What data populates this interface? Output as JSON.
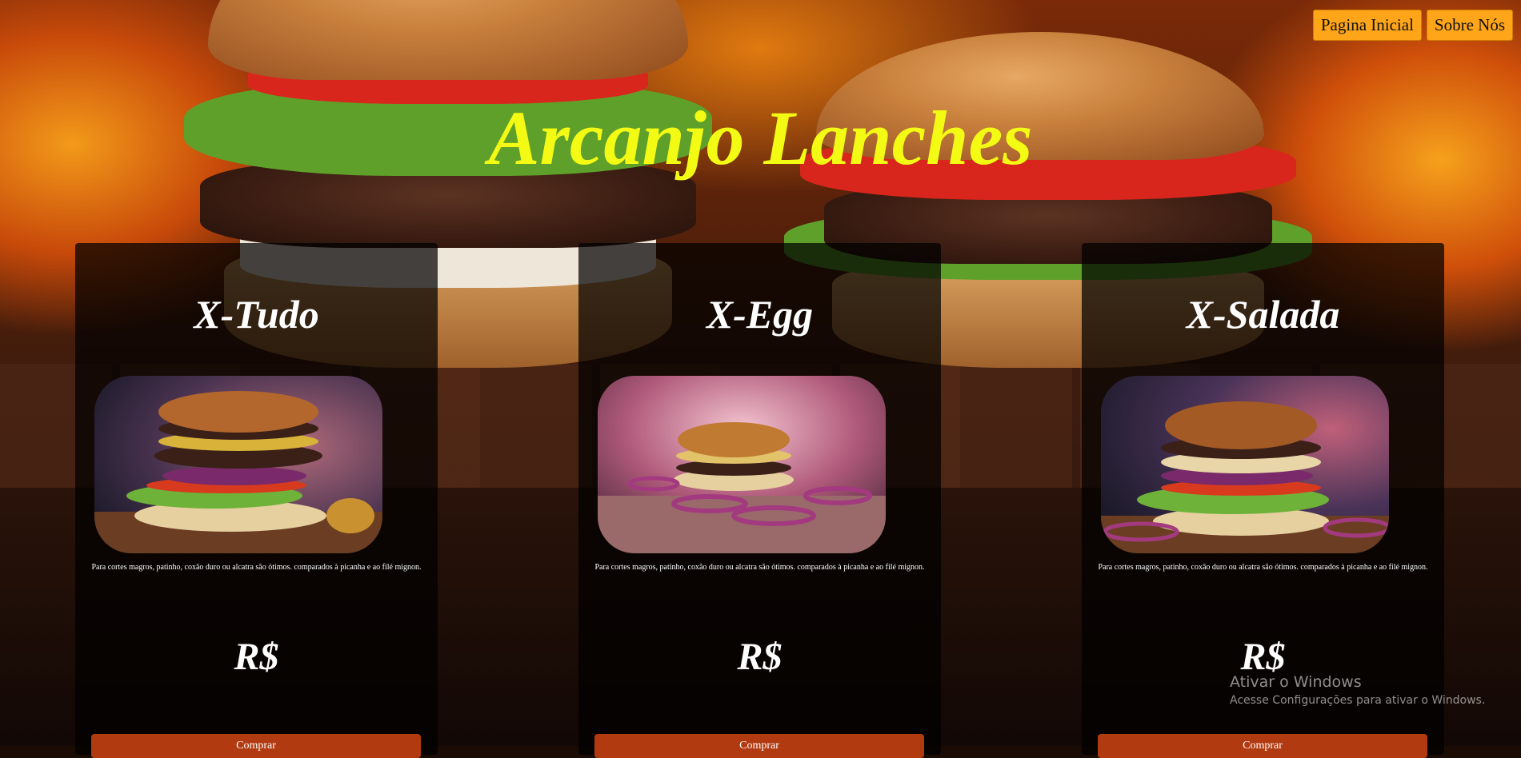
{
  "nav": {
    "items": [
      {
        "label": "Pagina Inicial"
      },
      {
        "label": "Sobre Nós"
      }
    ]
  },
  "site_title": "Arcanjo Lanches",
  "products": [
    {
      "name": "X-Tudo",
      "description": "Para cortes magros, patinho, coxão duro ou alcatra são ótimos. comparados à picanha e ao filé mignon.",
      "price": "R$",
      "button_label": "Comprar",
      "image_icon": "burger-image"
    },
    {
      "name": "X-Egg",
      "description": "Para cortes magros, patinho, coxão duro ou alcatra são ótimos. comparados à picanha e ao filé mignon.",
      "price": "R$",
      "button_label": "Comprar",
      "image_icon": "burger-image"
    },
    {
      "name": "X-Salada",
      "description": "Para cortes magros, patinho, coxão duro ou alcatra são ótimos. comparados à picanha e ao filé mignon.",
      "price": "R$",
      "button_label": "Comprar",
      "image_icon": "burger-image"
    }
  ],
  "watermark": {
    "title": "Ativar o Windows",
    "subtitle": "Acesse Configurações para ativar o Windows."
  },
  "colors": {
    "title": "#f3fb14",
    "nav_button": "#ffa51a",
    "buy_button": "#b23a10",
    "card_background": "rgba(0,0,0,0.72)"
  }
}
